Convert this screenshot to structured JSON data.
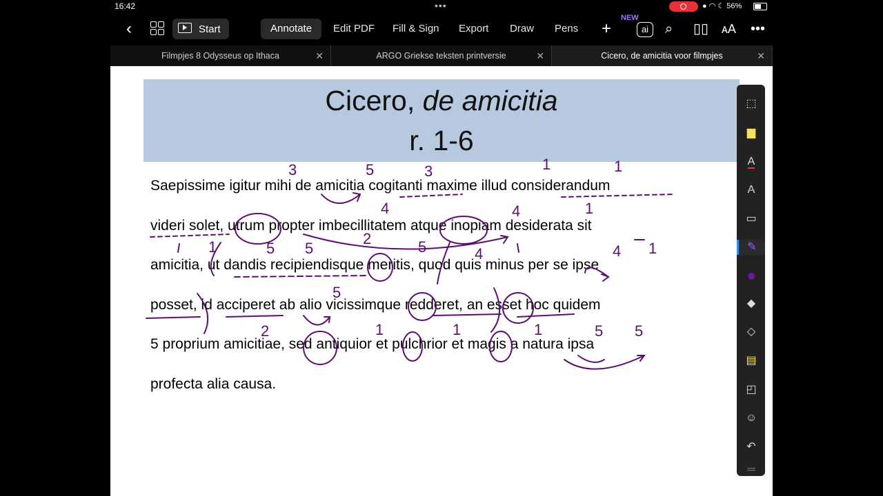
{
  "status": {
    "time": "16:42",
    "battery": "56%"
  },
  "toolbar": {
    "start_label": "Start",
    "items": [
      "Annotate",
      "Edit PDF",
      "Fill & Sign",
      "Export",
      "Draw",
      "Pens"
    ],
    "new_badge": "NEW",
    "ai_label": "ai"
  },
  "tabs": [
    {
      "label": "Filmpjes 8 Odysseus op Ithaca"
    },
    {
      "label": "ARGO Griekse teksten printversie"
    },
    {
      "label": "Cicero, de amicitia voor filmpjes"
    }
  ],
  "document": {
    "title_plain": "Cicero,",
    "title_italic": "de amicitia",
    "subtitle": "r. 1-6",
    "lines": [
      "Saepissime igitur mihi de amicitia cogitanti maxime illud considerandum",
      "videri solet, utrum propter imbecillitatem atque inopiam desiderata sit",
      "amicitia, ut dandis recipiendisque meritis, quod quis minus per se ipse",
      "posset, id acciperet ab alio vicissimque redderet, an esset hoc quidem",
      "5 proprium amicitiae, sed antiquior et pulchrior et magis a natura ipsa",
      "profecta alia causa."
    ],
    "annotations": [
      "3",
      "5",
      "3",
      "1",
      "1",
      "4",
      "4",
      "1",
      "5",
      "5",
      "2",
      "5",
      "4",
      "4",
      "1",
      "1",
      "5",
      "2",
      "1",
      "1",
      "1",
      "5",
      "5"
    ]
  },
  "colors": {
    "annotation": "#5a0f6e",
    "banner": "#b6c9df",
    "accent": "#2c8cff"
  }
}
